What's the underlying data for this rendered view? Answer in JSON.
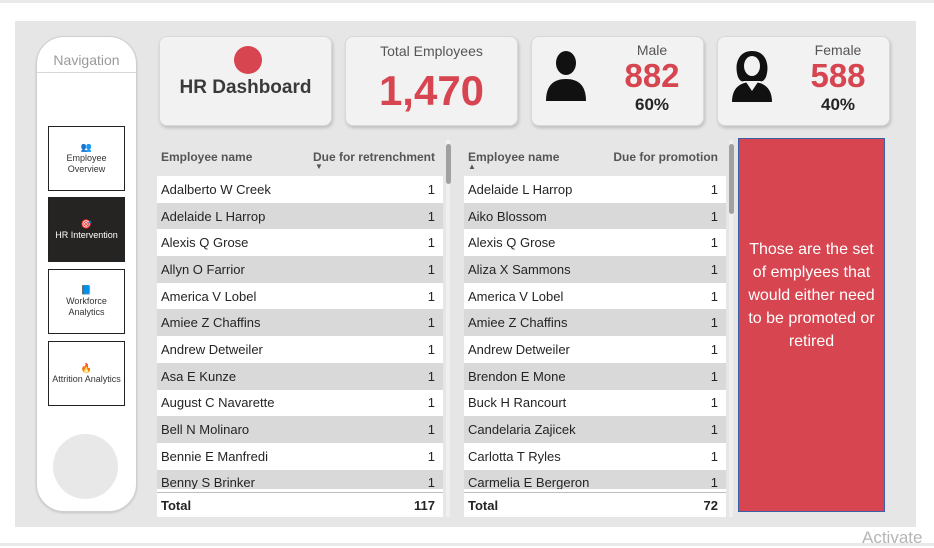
{
  "navigation": {
    "title": "Navigation",
    "items": [
      {
        "icon": "👥",
        "label": "Employee Overview",
        "icon_name": "people-icon"
      },
      {
        "icon": "🎯",
        "label": "HR Intervention",
        "icon_name": "target-icon"
      },
      {
        "icon": "📘",
        "label": "Workforce Analytics",
        "icon_name": "book-icon"
      },
      {
        "icon": "🔥",
        "label": "Attrition Analytics",
        "icon_name": "fire-icon"
      }
    ],
    "active_index": 1
  },
  "cards": {
    "title": "HR Dashboard",
    "total_label": "Total Employees",
    "total_value": "1,470",
    "male": {
      "label": "Male",
      "value": "882",
      "pct": "60%",
      "icon_name": "male-person-icon"
    },
    "female": {
      "label": "Female",
      "value": "588",
      "pct": "40%",
      "icon_name": "female-person-icon"
    }
  },
  "table_retrenchment": {
    "col_name": "Employee name",
    "col_value": "Due for retrenchment",
    "sort": "descending",
    "rows": [
      {
        "name": "Adalberto W Creek",
        "value": "1"
      },
      {
        "name": "Adelaide L Harrop",
        "value": "1"
      },
      {
        "name": "Alexis Q Grose",
        "value": "1"
      },
      {
        "name": "Allyn O Farrior",
        "value": "1"
      },
      {
        "name": "America V Lobel",
        "value": "1"
      },
      {
        "name": "Amiee Z Chaffins",
        "value": "1"
      },
      {
        "name": "Andrew Detweiler",
        "value": "1"
      },
      {
        "name": "Asa E Kunze",
        "value": "1"
      },
      {
        "name": "August C Navarette",
        "value": "1"
      },
      {
        "name": "Bell N Molinaro",
        "value": "1"
      },
      {
        "name": "Bennie E Manfredi",
        "value": "1"
      },
      {
        "name": "Benny S Brinker",
        "value": "1"
      }
    ],
    "total_label": "Total",
    "total_value": "117"
  },
  "table_promotion": {
    "col_name": "Employee name",
    "col_value": "Due for promotion",
    "sort": "ascending",
    "rows": [
      {
        "name": "Adelaide L Harrop",
        "value": "1"
      },
      {
        "name": "Aiko Blossom",
        "value": "1"
      },
      {
        "name": "Alexis Q Grose",
        "value": "1"
      },
      {
        "name": "Aliza X Sammons",
        "value": "1"
      },
      {
        "name": "America V Lobel",
        "value": "1"
      },
      {
        "name": "Amiee Z Chaffins",
        "value": "1"
      },
      {
        "name": "Andrew Detweiler",
        "value": "1"
      },
      {
        "name": "Brendon E Mone",
        "value": "1"
      },
      {
        "name": "Buck H Rancourt",
        "value": "1"
      },
      {
        "name": "Candelaria Zajicek",
        "value": "1"
      },
      {
        "name": "Carlotta T Ryles",
        "value": "1"
      },
      {
        "name": "Carmelia E Bergeron",
        "value": "1"
      }
    ],
    "total_label": "Total",
    "total_value": "72"
  },
  "note": {
    "text": "Those are the set of emplyees that would either need to be promoted or retired"
  },
  "watermark": "Activate",
  "colors": {
    "accent": "#d64550",
    "dark": "#252423",
    "background": "#e6e6e6"
  }
}
